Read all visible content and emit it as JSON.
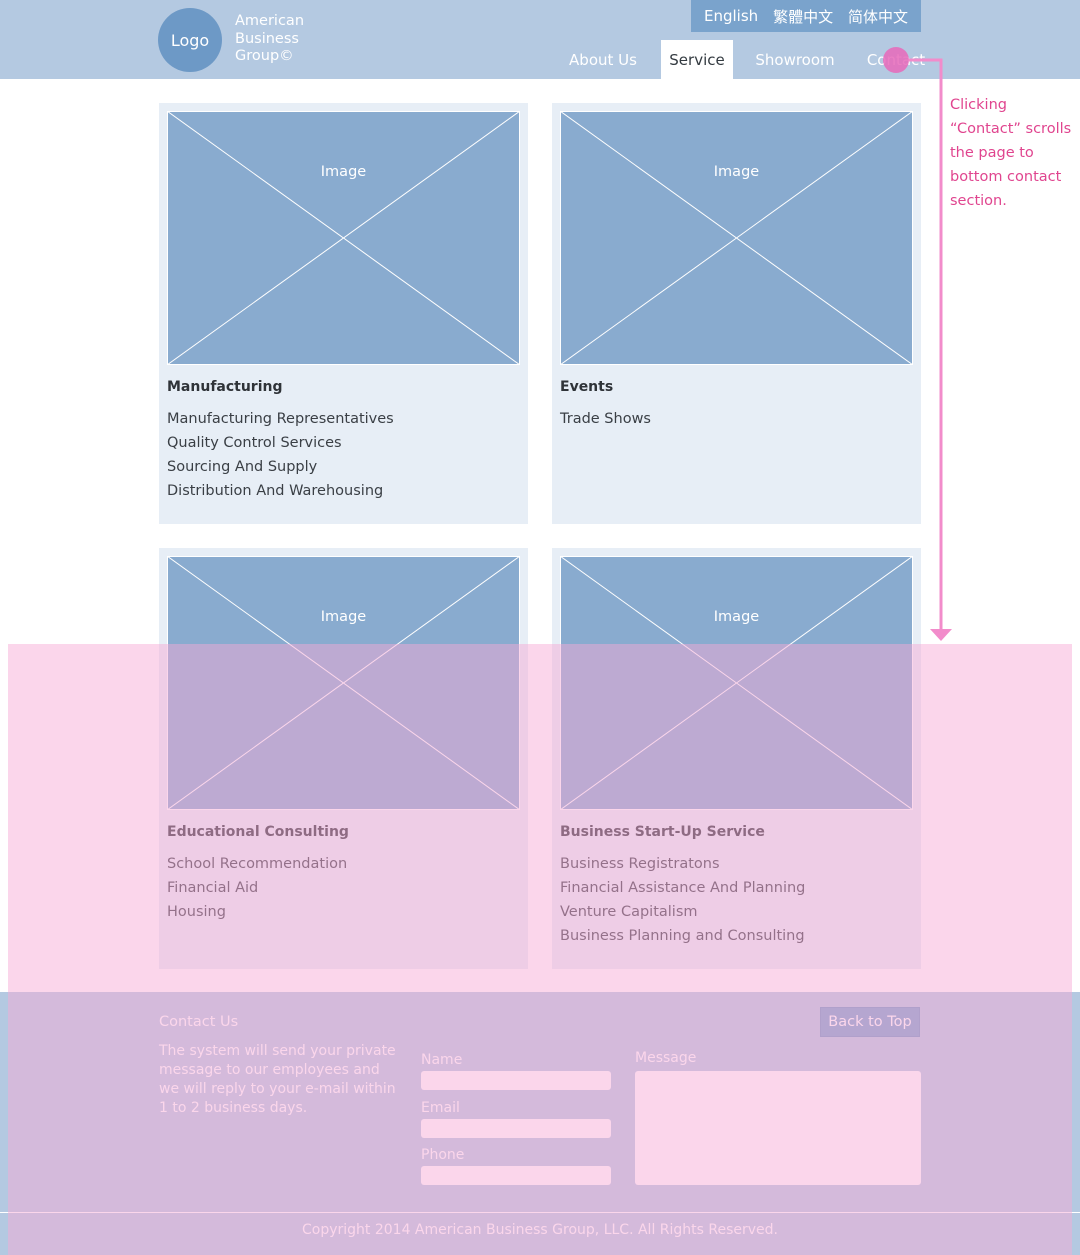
{
  "header": {
    "logo_text": "Logo",
    "brand": [
      "American",
      "Business",
      "Group©"
    ],
    "languages": [
      "English",
      "繁體中文",
      "简体中文"
    ],
    "nav": [
      "About Us",
      "Service",
      "Showroom",
      "Contact"
    ],
    "active_nav": "Service"
  },
  "cards": [
    {
      "image_label": "Image",
      "title": "Manufacturing",
      "items": [
        "Manufacturing Representatives",
        "Quality Control Services",
        "Sourcing And Supply",
        "Distribution And Warehousing"
      ]
    },
    {
      "image_label": "Image",
      "title": "Events",
      "items": [
        "Trade Shows"
      ]
    },
    {
      "image_label": "Image",
      "title": "Educational Consulting",
      "items": [
        "School Recommendation",
        "Financial Aid",
        "Housing"
      ]
    },
    {
      "image_label": "Image",
      "title": "Business Start-Up Service",
      "items": [
        "Business Registratons",
        "Financial Assistance And Planning",
        "Venture Capitalism",
        "Business Planning and Consulting"
      ]
    }
  ],
  "contact": {
    "title": "Contact Us",
    "description": "The system will send your private message to our employees and we will reply to your e-mail within 1 to 2 business days.",
    "name_label": "Name",
    "email_label": "Email",
    "phone_label": "Phone",
    "message_label": "Message",
    "back_to_top": "Back to Top"
  },
  "footer": {
    "copyright": "Copyright 2014 American Business Group, LLC. All Rights Reserved."
  },
  "annotation": {
    "text": "Clicking “Contact” scrolls the page to bottom contact section."
  },
  "colors": {
    "header_bg": "#b4c9e1",
    "lang_bar_bg": "#7aa3cc",
    "card_bg": "#e7eef6",
    "image_placeholder": "#89abcf",
    "annotation_pink": "#e0458f",
    "overlay_pink": "#f7aad6"
  }
}
